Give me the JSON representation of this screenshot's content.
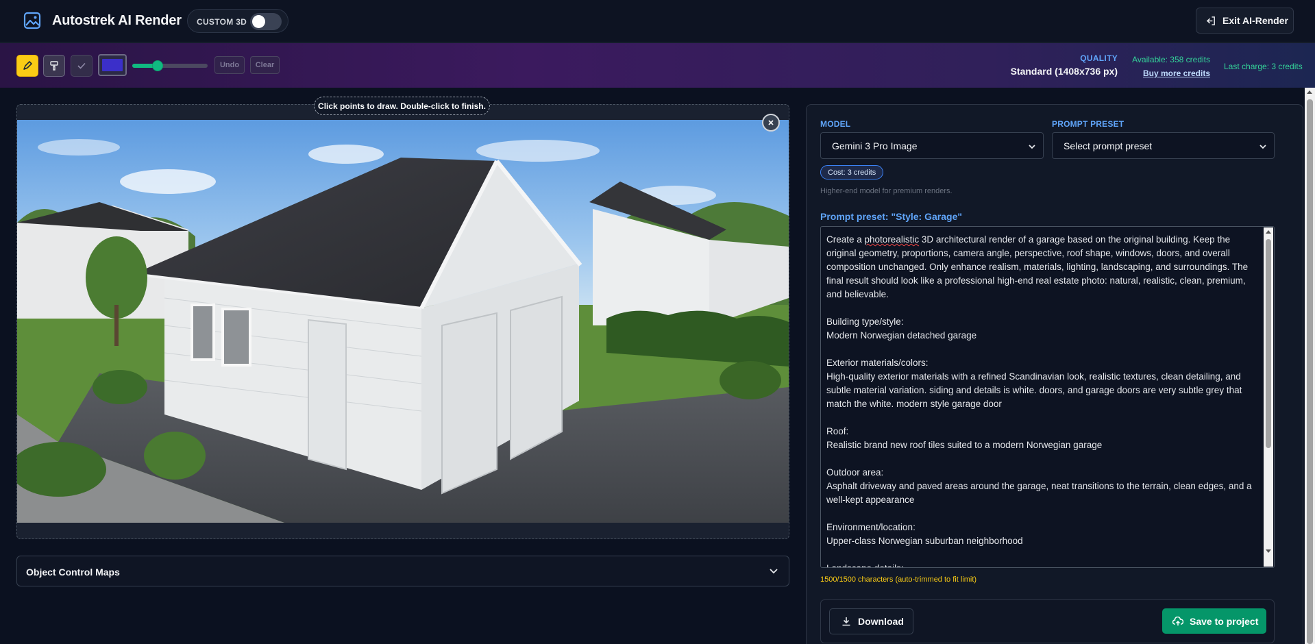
{
  "header": {
    "title": "Autostrek AI Render",
    "custom3d_label": "CUSTOM 3D",
    "custom3d_on": false,
    "exit_label": "Exit AI-Render"
  },
  "toolbar": {
    "tools": [
      "pen-icon",
      "brush-icon",
      "check-icon"
    ],
    "active_tool": "pen",
    "color": "#3b2fc9",
    "brush_size_fraction": 0.3,
    "undo_label": "Undo",
    "clear_label": "Clear",
    "quality_label": "QUALITY",
    "quality_value": "Standard (1408x736 px)",
    "available_credits": "Available: 358 credits",
    "buy_credits": "Buy more credits",
    "last_charge": "Last charge: 3 credits"
  },
  "canvas": {
    "hint": "Click points to draw. Double-click to finish."
  },
  "object_control": {
    "title": "Object Control Maps"
  },
  "panel": {
    "model_label": "MODEL",
    "model_value": "Gemini 3 Pro Image",
    "preset_label": "PROMPT PRESET",
    "preset_value": "Select prompt preset",
    "cost": "Cost: 3 credits",
    "model_note": "Higher-end model for premium renders.",
    "preset_title": "Prompt preset: \"Style: Garage\"",
    "prompt_before": "Create a ",
    "prompt_spell": "photorealistic",
    "prompt_after": " 3D architectural render of a garage based on the original building. Keep the original geometry, proportions, camera angle, perspective, roof shape, windows, doors, and overall composition unchanged. Only enhance realism, materials, lighting, landscaping, and surroundings. The final result should look like a professional high-end real estate photo: natural, realistic, clean, premium, and believable.\n\nBuilding type/style:\nModern Norwegian detached garage\n\nExterior materials/colors:\nHigh-quality exterior materials with a refined Scandinavian look, realistic textures, clean detailing, and subtle material variation. siding and details is white. doors, and garage doors are very subtle grey that match the white. modern style garage door\n\nRoof:\nRealistic brand new roof tiles suited to a modern Norwegian garage\n\nOutdoor area:\nAsphalt driveway and paved areas around the garage, neat transitions to the terrain, clean edges, and a well-kept appearance\n\nEnvironment/location:\nUpper-class Norwegian suburban neighborhood\n\nLandscape details:",
    "char_count": "1500/1500 characters (auto-trimmed to fit limit)",
    "download_label": "Download",
    "save_label": "Save to project"
  }
}
